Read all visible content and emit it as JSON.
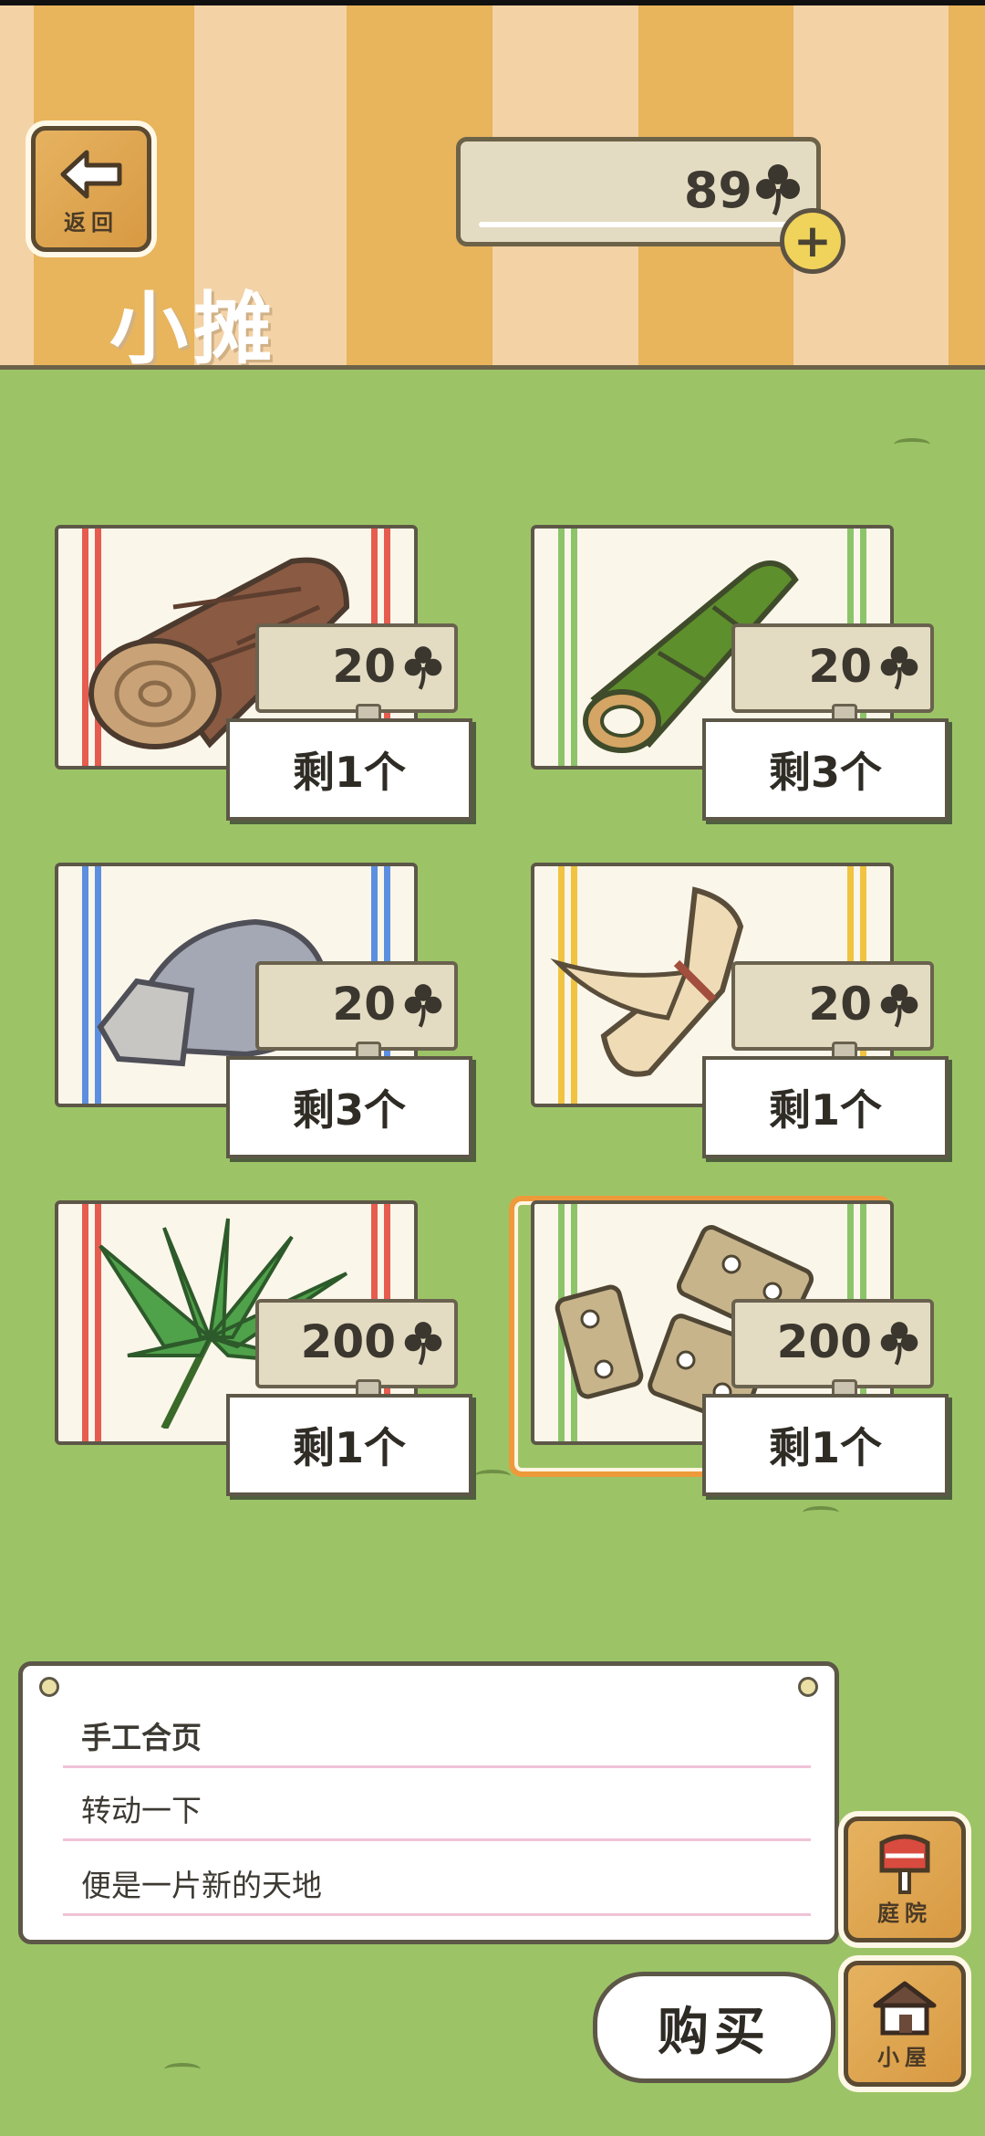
{
  "header": {
    "back_label": "返回",
    "title": "小摊",
    "coins": "89",
    "coin_icon": "clover-icon"
  },
  "shop": {
    "items": [
      {
        "name": "log",
        "price": "20",
        "stock": "剩1个",
        "stripe_color": "#e65c4f"
      },
      {
        "name": "bamboo",
        "price": "20",
        "stock": "剩3个",
        "stripe_color": "#8cc46a"
      },
      {
        "name": "stone",
        "price": "20",
        "stock": "剩3个",
        "stripe_color": "#5d8fe0"
      },
      {
        "name": "straw-bundle",
        "price": "20",
        "stock": "剩1个",
        "stripe_color": "#f0c441"
      },
      {
        "name": "palm-leaf",
        "price": "200",
        "stock": "剩1个",
        "stripe_color": "#e65c4f"
      },
      {
        "name": "hinges",
        "price": "200",
        "stock": "剩1个",
        "stripe_color": "#8cc46a",
        "selected": true
      }
    ]
  },
  "description": {
    "lines": [
      "手工合页",
      "转动一下",
      "便是一片新的天地"
    ]
  },
  "buttons": {
    "buy": "购买",
    "yard": "庭院",
    "house": "小屋"
  }
}
